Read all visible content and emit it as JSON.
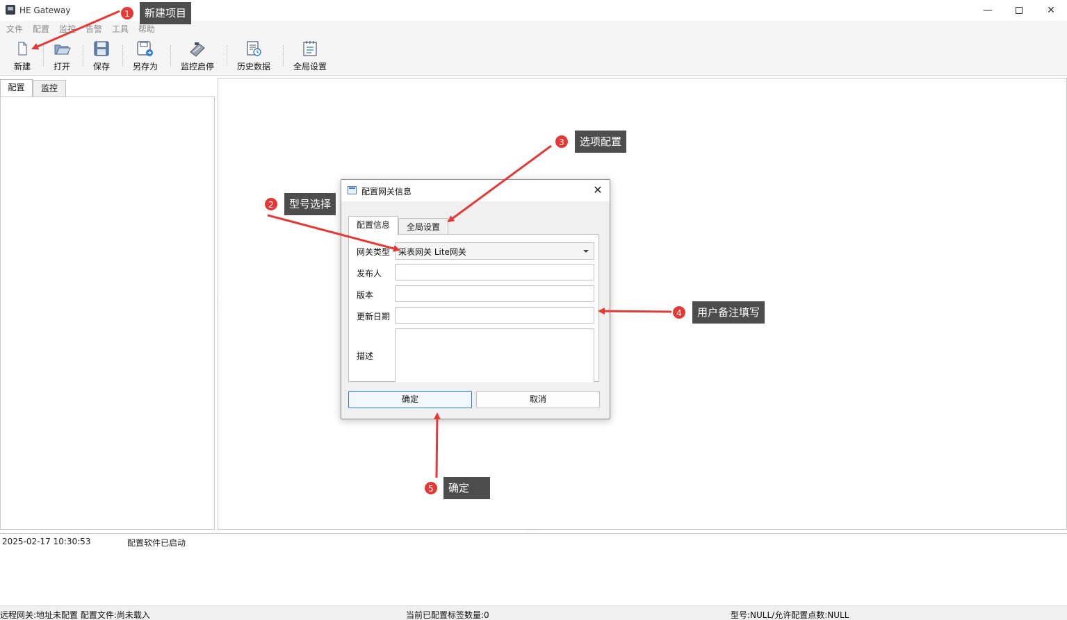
{
  "window": {
    "title": "HE Gateway",
    "controls": {
      "minimize": "—",
      "close": "✕"
    }
  },
  "menu": [
    "文件",
    "配置",
    "监控",
    "告警",
    "工具",
    "帮助"
  ],
  "toolbar": [
    {
      "label": "新建",
      "icon": "new-file-icon"
    },
    {
      "label": "打开",
      "icon": "open-folder-icon"
    },
    {
      "label": "保存",
      "icon": "save-disk-icon"
    },
    {
      "label": "另存为",
      "icon": "save-as-icon"
    },
    {
      "label": "监控启停",
      "icon": "monitor-toggle-icon"
    },
    {
      "label": "历史数据",
      "icon": "history-data-icon"
    },
    {
      "label": "全局设置",
      "icon": "global-settings-icon"
    }
  ],
  "left_tabs": [
    "配置",
    "监控"
  ],
  "log": {
    "time": "2025-02-17 10:30:53",
    "message": "配置软件已启动"
  },
  "status": {
    "left": "远程网关:地址未配置  配置文件:尚未载入",
    "center": "当前已配置标签数量:0",
    "right": "型号:NULL/允许配置点数:NULL"
  },
  "dialog": {
    "title": "配置网关信息",
    "close": "✕",
    "tabs": [
      "配置信息",
      "全局设置"
    ],
    "fields": {
      "gateway_type_label": "网关类型",
      "gateway_type_value": "采表网关 Lite网关",
      "publisher_label": "发布人",
      "publisher_value": "",
      "version_label": "版本",
      "version_value": "",
      "update_date_label": "更新日期",
      "update_date_value": "",
      "description_label": "描述"
    },
    "ok": "确定",
    "cancel": "取消"
  },
  "annotations": [
    {
      "num": "1",
      "text": "新建项目"
    },
    {
      "num": "2",
      "text": "型号选择"
    },
    {
      "num": "3",
      "text": "选项配置"
    },
    {
      "num": "4",
      "text": "用户备注填写"
    },
    {
      "num": "5",
      "text": "确定"
    }
  ],
  "colors": {
    "annotation_red": "#e53935",
    "annotation_label_bg": "#4d4d4d",
    "primary_button_border": "#2f7ad6"
  }
}
